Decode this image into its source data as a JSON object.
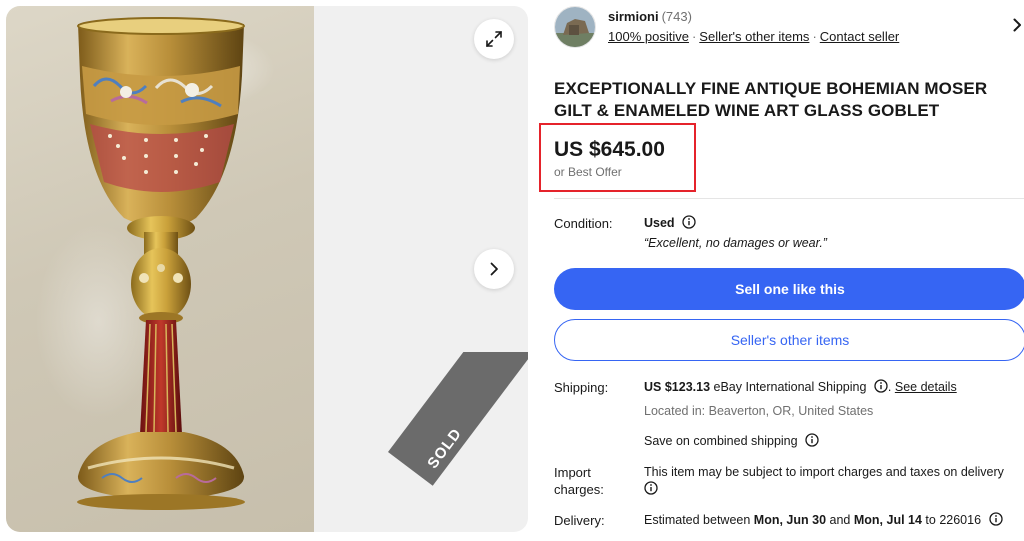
{
  "gallery": {
    "expand_icon": "expand-arrows-icon",
    "next_icon": "chevron-right-icon",
    "sold_label": "SOLD",
    "image_alt": "goblet-photo"
  },
  "seller": {
    "name": "sirmioni",
    "count": "(743)",
    "positive": "100% positive",
    "other_items": "Seller's other items",
    "contact": "Contact seller"
  },
  "listing": {
    "title_line1": "EXCEPTIONALLY FINE ANTIQUE BOHEMIAN MOSER",
    "title_line2": "GILT & ENAMELED WINE ART GLASS GOBLET",
    "price": "US $645.00",
    "price_note": "or Best Offer"
  },
  "condition": {
    "label": "Condition:",
    "value": "Used",
    "note": "“Excellent, no damages or wear.”"
  },
  "actions": {
    "primary": "Sell one like this",
    "secondary": "Seller's other items"
  },
  "shipping": {
    "label": "Shipping:",
    "amount": "US $123.13",
    "method": "eBay International Shipping",
    "details_link": "See details",
    "location": "Located in: Beaverton, OR, United States",
    "combined": "Save on combined shipping"
  },
  "import": {
    "label_line1": "Import",
    "label_line2": "charges:",
    "text": "This item may be subject to import charges and taxes on delivery"
  },
  "delivery": {
    "label": "Delivery:",
    "prefix": "Estimated between",
    "start": "Mon, Jun 30",
    "and": "and",
    "end": "Mon, Jul 14",
    "to": "to 226016"
  },
  "colors": {
    "accent": "#3665f3",
    "highlight_box": "#e5232b",
    "sold_ribbon": "#6b6b6b",
    "text_muted": "#707070"
  }
}
